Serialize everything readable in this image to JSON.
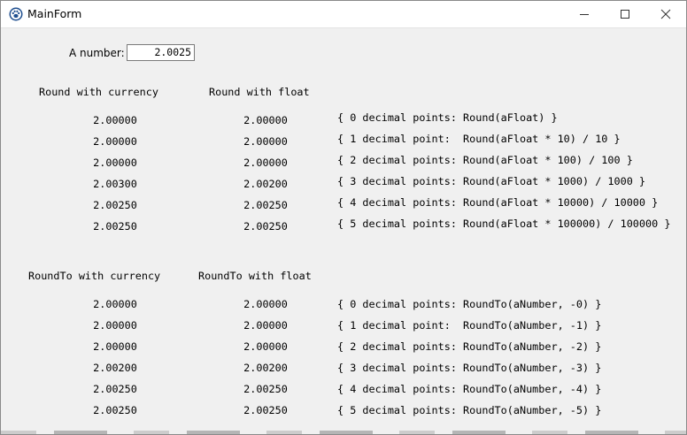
{
  "window": {
    "title": "MainForm",
    "app_icon": "paw-icon",
    "controls": [
      "minimize-icon",
      "maximize-icon",
      "close-icon"
    ]
  },
  "input": {
    "label": "A number:",
    "value": "2.0025"
  },
  "round_section": {
    "currency_header": "Round with currency",
    "float_header": "Round with float",
    "rows": [
      {
        "currency": "2.00000",
        "float": "2.00000",
        "comment": "{ 0 decimal points: Round(aFloat) }"
      },
      {
        "currency": "2.00000",
        "float": "2.00000",
        "comment": "{ 1 decimal point:  Round(aFloat * 10) / 10 }"
      },
      {
        "currency": "2.00000",
        "float": "2.00000",
        "comment": "{ 2 decimal points: Round(aFloat * 100) / 100 }"
      },
      {
        "currency": "2.00300",
        "float": "2.00200",
        "comment": "{ 3 decimal points: Round(aFloat * 1000) / 1000 }"
      },
      {
        "currency": "2.00250",
        "float": "2.00250",
        "comment": "{ 4 decimal points: Round(aFloat * 10000) / 10000 }"
      },
      {
        "currency": "2.00250",
        "float": "2.00250",
        "comment": "{ 5 decimal points: Round(aFloat * 100000) / 100000 }"
      }
    ]
  },
  "roundto_section": {
    "currency_header": "RoundTo with currency",
    "float_header": "RoundTo with float",
    "rows": [
      {
        "currency": "2.00000",
        "float": "2.00000",
        "comment": "{ 0 decimal points: RoundTo(aNumber, -0) }"
      },
      {
        "currency": "2.00000",
        "float": "2.00000",
        "comment": "{ 1 decimal point:  RoundTo(aNumber, -1) }"
      },
      {
        "currency": "2.00000",
        "float": "2.00000",
        "comment": "{ 2 decimal points: RoundTo(aNumber, -2) }"
      },
      {
        "currency": "2.00200",
        "float": "2.00200",
        "comment": "{ 3 decimal points: RoundTo(aNumber, -3) }"
      },
      {
        "currency": "2.00250",
        "float": "2.00250",
        "comment": "{ 4 decimal points: RoundTo(aNumber, -4) }"
      },
      {
        "currency": "2.00250",
        "float": "2.00250",
        "comment": "{ 5 decimal points: RoundTo(aNumber, -5) }"
      }
    ]
  }
}
